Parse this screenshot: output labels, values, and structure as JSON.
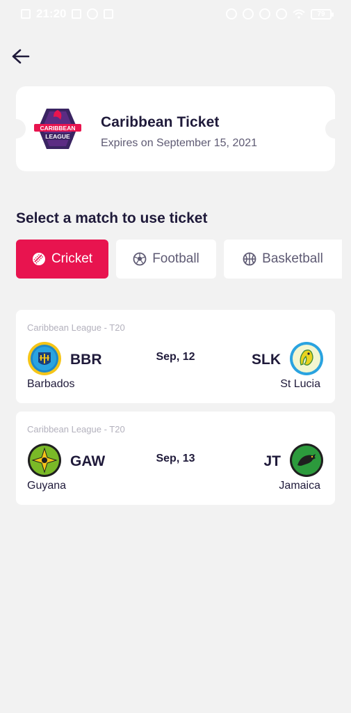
{
  "status_bar": {
    "time": "21:20",
    "battery": "79"
  },
  "ticket": {
    "logo_text_line1": "CARIBBEAN",
    "logo_text_line2": "LEAGUE",
    "title": "Caribbean Ticket",
    "expiry": "Expires on September 15, 2021"
  },
  "section_title": "Select a match to use ticket",
  "tabs": [
    {
      "label": "Cricket",
      "icon": "cricket-ball-icon",
      "active": true
    },
    {
      "label": "Football",
      "icon": "football-icon",
      "active": false
    },
    {
      "label": "Basketball",
      "icon": "basketball-icon",
      "active": false
    }
  ],
  "matches": [
    {
      "league": "Caribbean League - T20",
      "date": "Sep, 12",
      "home": {
        "code": "BBR",
        "name": "Barbados"
      },
      "away": {
        "code": "SLK",
        "name": "St Lucia"
      }
    },
    {
      "league": "Caribbean League - T20",
      "date": "Sep, 13",
      "home": {
        "code": "GAW",
        "name": "Guyana"
      },
      "away": {
        "code": "JT",
        "name": "Jamaica"
      }
    }
  ],
  "colors": {
    "accent": "#e8144f",
    "background": "#f2f2f2",
    "card": "#ffffff",
    "text_primary": "#1f1a3a",
    "text_secondary": "#5e5a73",
    "text_muted": "#b3b1bd"
  }
}
